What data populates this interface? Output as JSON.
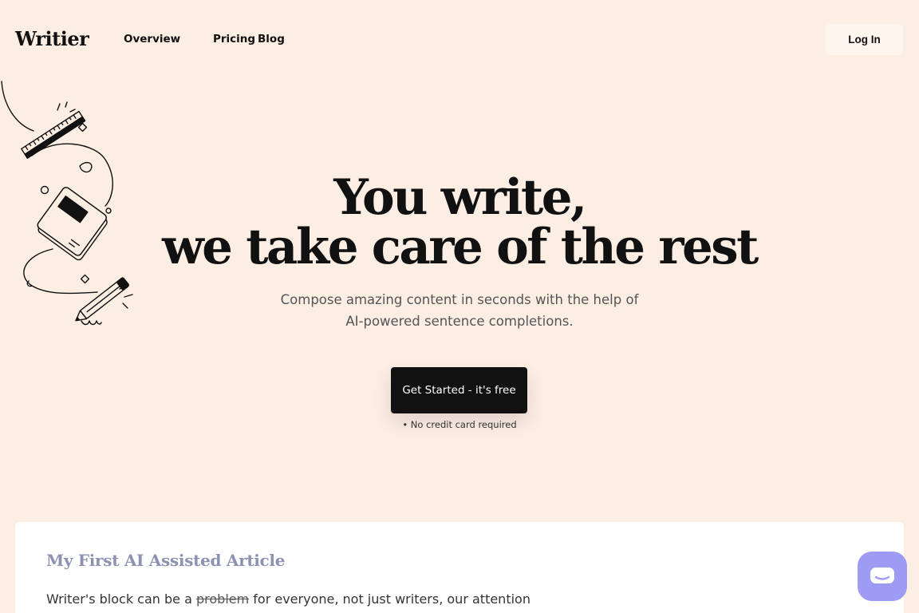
{
  "header": {
    "logo": "Writier",
    "nav": [
      "Overview",
      "Pricing",
      "Blog"
    ],
    "login_label": "Log In"
  },
  "hero": {
    "title_line1": "You write,",
    "title_line2": "we take care of the rest",
    "subtitle_line1": "Compose amazing content in seconds with the help of",
    "subtitle_line2": "AI-powered sentence completions.",
    "cta_label": "Get Started - it's free",
    "cta_note": "• No credit card required"
  },
  "article": {
    "title": "My First AI Assisted Article",
    "body_before": "Writer's block can be a ",
    "body_struck": "problem",
    "body_after": " for everyone, not just writers, our attention"
  },
  "icons": {
    "chat": "chat-bubble-icon",
    "illustration": "stationery-doodle-illustration"
  },
  "colors": {
    "background": "#fdeee4",
    "cta": "#111111",
    "chat_widget": "#9e9bf5",
    "article_title": "#8d92b3"
  }
}
